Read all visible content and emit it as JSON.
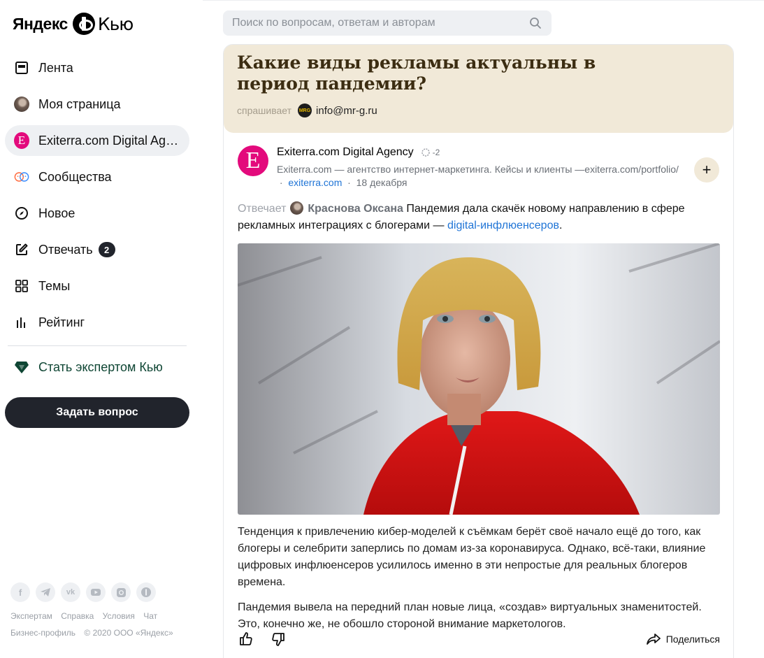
{
  "logo": {
    "yandex": "Яндекс",
    "product": "Кью"
  },
  "search": {
    "placeholder": "Поиск по вопросам, ответам и авторам",
    "icon": "search-icon"
  },
  "sidebar": {
    "items": [
      {
        "label": "Лента",
        "icon": "feed-icon"
      },
      {
        "label": "Моя страница",
        "icon": "user-avatar"
      },
      {
        "label": "Exiterra.com Digital Agency",
        "icon": "exiterra-avatar",
        "active": true
      },
      {
        "label": "Сообщества",
        "icon": "communities-icon"
      },
      {
        "label": "Новое",
        "icon": "compass-icon"
      },
      {
        "label": "Отвечать",
        "icon": "edit-icon",
        "badge": "2"
      },
      {
        "label": "Темы",
        "icon": "grid-icon"
      },
      {
        "label": "Рейтинг",
        "icon": "rating-icon"
      }
    ],
    "expert_label": "Стать экспертом Кью",
    "ask_button": "Задать вопрос"
  },
  "footer": {
    "socials": [
      "facebook-icon",
      "telegram-icon",
      "vk-icon",
      "youtube-icon",
      "instagram-icon",
      "zen-icon"
    ],
    "links": [
      "Экспертам",
      "Справка",
      "Условия",
      "Чат"
    ],
    "business": "Бизнес-профиль",
    "copyright": "© 2020 ООО «Яндекс»"
  },
  "question": {
    "title": "Какие виды рекламы актуальны в период пандемии?",
    "asked_label": "спрашивает",
    "asker_logo": "MRG",
    "asker": "info@mr-g.ru"
  },
  "answer": {
    "author_initial": "E",
    "author": "Exiterra.com Digital Agency",
    "rating": "-2",
    "description": "Exiterra.com — агентство интернет-маркетинга. Кейсы и клиенты —exiterra.com/portfolio/",
    "site": "exiterra.com",
    "separator": "·",
    "date": "18 декабря",
    "follow": "+",
    "answers_label": "Отвечает",
    "answerer": "Краснова Оксана",
    "intro": "Пандемия дала скачёк новому направлению в сфере рекламных интеграциях с блогерами —",
    "link": "digital-инфлюенсеров",
    "intro_end": ".",
    "paragraph_1": "Тенденция к привлечению кибер-моделей к съёмкам берёт своё начало ещё до того, как блогеры и селебрити заперлись по домам из-за коронавируса. Однако, всё-таки, влияние цифровых инфлюенсеров усилилось именно в эти непростые для реальных блогеров времена.",
    "paragraph_2": "Пандемия вывела на передний план новые лица, «создав» виртуальных знаменитостей. Это, конечно же, не обошло стороной внимание маркетологов.",
    "share": "Поделиться"
  },
  "colors": {
    "accent_dark": "#21242c",
    "question_bg": "#f1e9d8",
    "brand_pink": "#e30a7c",
    "link": "#1f74d6"
  }
}
